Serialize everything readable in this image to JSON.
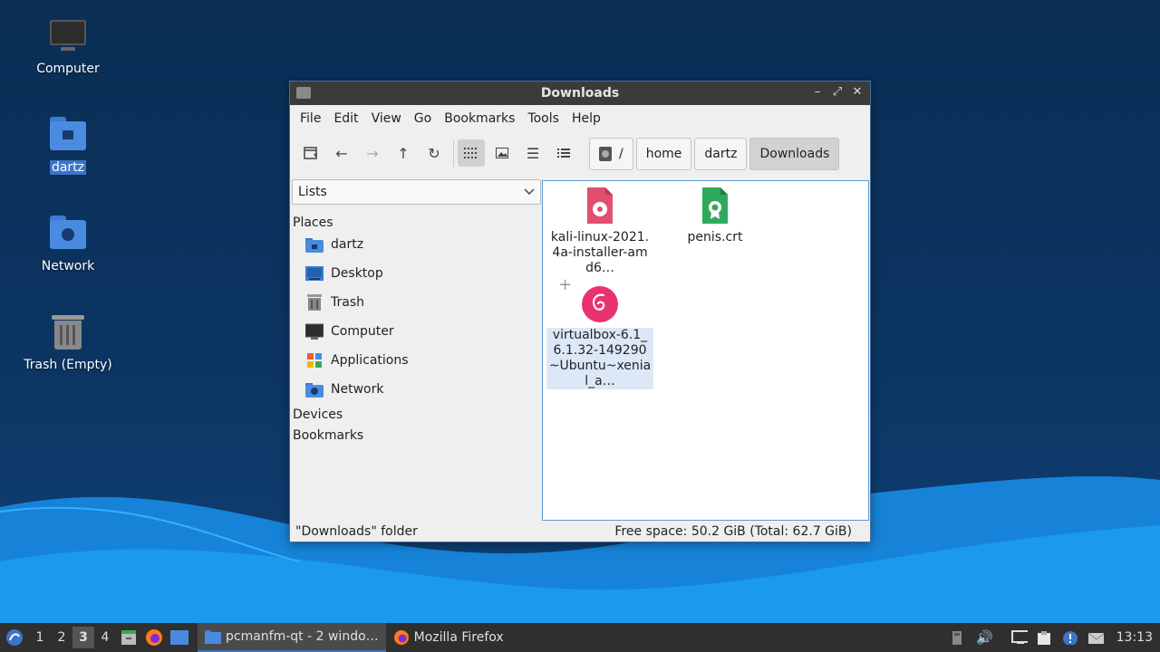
{
  "desktop": {
    "icons": [
      {
        "label": "Computer",
        "icon": "computer-icon"
      },
      {
        "label": "dartz",
        "icon": "home-folder-icon",
        "selected": true
      },
      {
        "label": "Network",
        "icon": "network-folder-icon"
      },
      {
        "label": "Trash (Empty)",
        "icon": "trash-icon"
      }
    ]
  },
  "window": {
    "title": "Downloads",
    "controls": {
      "minimize": "–",
      "maximize": "⤢",
      "close": "✕"
    },
    "menu": [
      "File",
      "Edit",
      "View",
      "Go",
      "Bookmarks",
      "Tools",
      "Help"
    ],
    "toolbar": {
      "icons": [
        "new-tab-icon",
        "back-arrow-icon",
        "forward-arrow-icon",
        "up-arrow-icon",
        "reload-icon",
        "icon-view-icon",
        "thumbnail-view-icon",
        "compact-view-icon",
        "detailed-list-view-icon"
      ]
    },
    "breadcrumb": [
      "/",
      "home",
      "dartz",
      "Downloads"
    ],
    "sidebar": {
      "mode": "Lists",
      "places_header": "Places",
      "places": [
        {
          "label": "dartz",
          "icon": "home-folder-icon"
        },
        {
          "label": "Desktop",
          "icon": "desktop-icon"
        },
        {
          "label": "Trash",
          "icon": "trash-icon"
        },
        {
          "label": "Computer",
          "icon": "computer-icon"
        },
        {
          "label": "Applications",
          "icon": "applications-icon"
        },
        {
          "label": "Network",
          "icon": "network-icon"
        }
      ],
      "devices_header": "Devices",
      "bookmarks_header": "Bookmarks"
    },
    "files": [
      {
        "name": "kali-linux-2021.4a-installer-amd6…",
        "icon": "disc-image-icon",
        "selected": false
      },
      {
        "name": "penis.crt",
        "icon": "certificate-icon",
        "selected": false
      },
      {
        "name": "virtualbox-6.1_6.1.32-149290~Ubuntu~xenial_a…",
        "icon": "debian-package-icon",
        "selected": true
      }
    ],
    "status": {
      "left": "\"Downloads\" folder",
      "right": "Free space: 50.2 GiB (Total: 62.7 GiB)"
    }
  },
  "taskbar": {
    "workspaces": [
      "1",
      "2",
      "3",
      "4"
    ],
    "current_workspace": "3",
    "tasks": [
      {
        "label": "pcmanfm-qt - 2 windo…",
        "icon": "folder-icon",
        "active": true
      },
      {
        "label": "Mozilla Firefox",
        "icon": "firefox-icon",
        "active": false
      }
    ],
    "clock": "13:13"
  },
  "colors": {
    "accent": "#3d74c7",
    "titlebar": "#3b3b3b",
    "taskbar": "#2f2f2f",
    "desktop": "#0c3563"
  }
}
